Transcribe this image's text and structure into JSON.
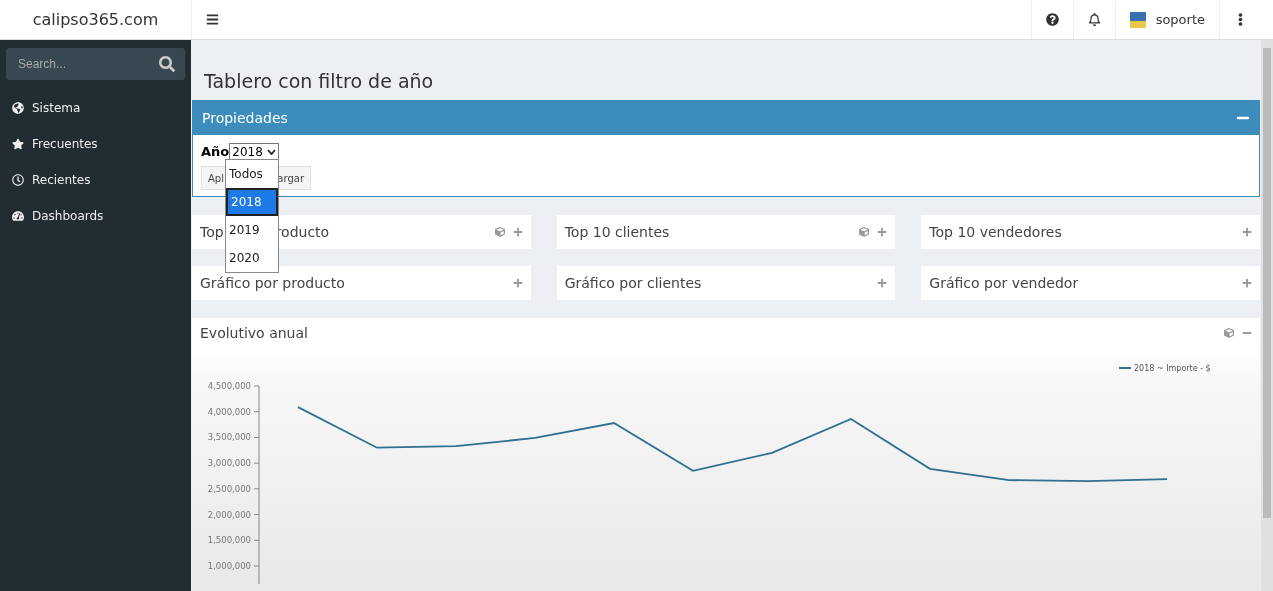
{
  "brand": "calipso365.com",
  "topbar": {
    "user": "soporte"
  },
  "search": {
    "placeholder": "Search..."
  },
  "sidebar": {
    "items": [
      {
        "label": "Sistema"
      },
      {
        "label": "Frecuentes"
      },
      {
        "label": "Recientes"
      },
      {
        "label": "Dashboards"
      }
    ]
  },
  "page_title": "Tablero con filtro de año",
  "properties": {
    "title": "Propiedades",
    "year_label": "Año",
    "year_value": "2018",
    "buttons": [
      "Apl",
      "argar"
    ],
    "options": [
      {
        "label": "Todos",
        "selected": false
      },
      {
        "label": "2018",
        "selected": true
      },
      {
        "label": "2019",
        "selected": false
      },
      {
        "label": "2020",
        "selected": false
      }
    ]
  },
  "cards": [
    {
      "title": "Top",
      "title_tail": "roducto",
      "cube": true
    },
    {
      "title": "Top 10 clientes",
      "cube": true
    },
    {
      "title": "Top 10 vendedores",
      "cube": false
    },
    {
      "title": "Gráfico por producto",
      "cube": false
    },
    {
      "title": "Gráfico por clientes",
      "cube": false
    },
    {
      "title": "Gráfico por vendedor",
      "cube": false
    }
  ],
  "evolution": {
    "title": "Evolutivo anual",
    "chart_data": {
      "type": "line",
      "categories": [
        null,
        null,
        null,
        null,
        null,
        null,
        null,
        null,
        null,
        null,
        null,
        null
      ],
      "ylim": [
        650000,
        4500000
      ],
      "yticks": [
        {
          "value": 1000000,
          "label": "1,000,000"
        },
        {
          "value": 1500000,
          "label": "1,500,000"
        },
        {
          "value": 2000000,
          "label": "2,000,000"
        },
        {
          "value": 2500000,
          "label": "2,500,000"
        },
        {
          "value": 3000000,
          "label": "3,000,000"
        },
        {
          "value": 3500000,
          "label": "3,500,000"
        },
        {
          "value": 4000000,
          "label": "4,000,000"
        },
        {
          "value": 4500000,
          "label": "4,500,000"
        }
      ],
      "series": [
        {
          "name": "2018 ~ Importe - $",
          "color": "#2f6f8f",
          "values": [
            4090000,
            3300000,
            3330000,
            3490000,
            3780000,
            2850000,
            3200000,
            3860000,
            2890000,
            2670000,
            2650000,
            2690000
          ]
        }
      ]
    }
  }
}
